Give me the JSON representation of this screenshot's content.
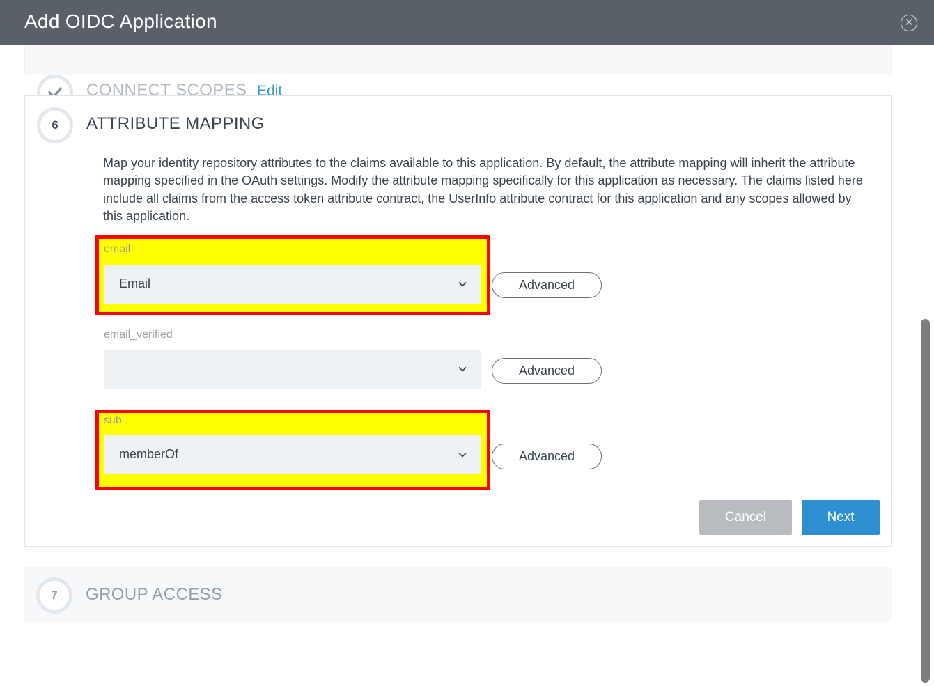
{
  "dialog": {
    "title": "Add OIDC Application",
    "close_icon": "close-icon"
  },
  "steps": {
    "connect_scopes": {
      "title": "CONNECT SCOPES",
      "edit_label": "Edit",
      "icon": "checkmark-icon"
    },
    "attribute_mapping": {
      "number": "6",
      "title": "ATTRIBUTE MAPPING",
      "description": "Map your identity repository attributes to the claims available to this application. By default, the attribute mapping will inherit the attribute mapping specified in the OAuth settings. Modify the attribute mapping specifically for this application as necessary. The claims listed here include all claims from the access token attribute contract, the UserInfo attribute contract for this application and any scopes allowed by this application.",
      "mappings": [
        {
          "claim": "email",
          "value": "Email",
          "advanced_label": "Advanced",
          "highlighted": true
        },
        {
          "claim": "email_verified",
          "value": "",
          "advanced_label": "Advanced",
          "highlighted": false
        },
        {
          "claim": "sub",
          "value": "memberOf",
          "advanced_label": "Advanced",
          "highlighted": true
        }
      ],
      "cancel_label": "Cancel",
      "next_label": "Next"
    },
    "group_access": {
      "number": "7",
      "title": "GROUP ACCESS"
    }
  },
  "colors": {
    "title_bar": "#5a6068",
    "highlight_fill": "#ffff00",
    "highlight_border": "#ff0000",
    "next_button": "#2e8fd0",
    "cancel_button": "#b8bcc0",
    "link": "#3d9bd4"
  }
}
